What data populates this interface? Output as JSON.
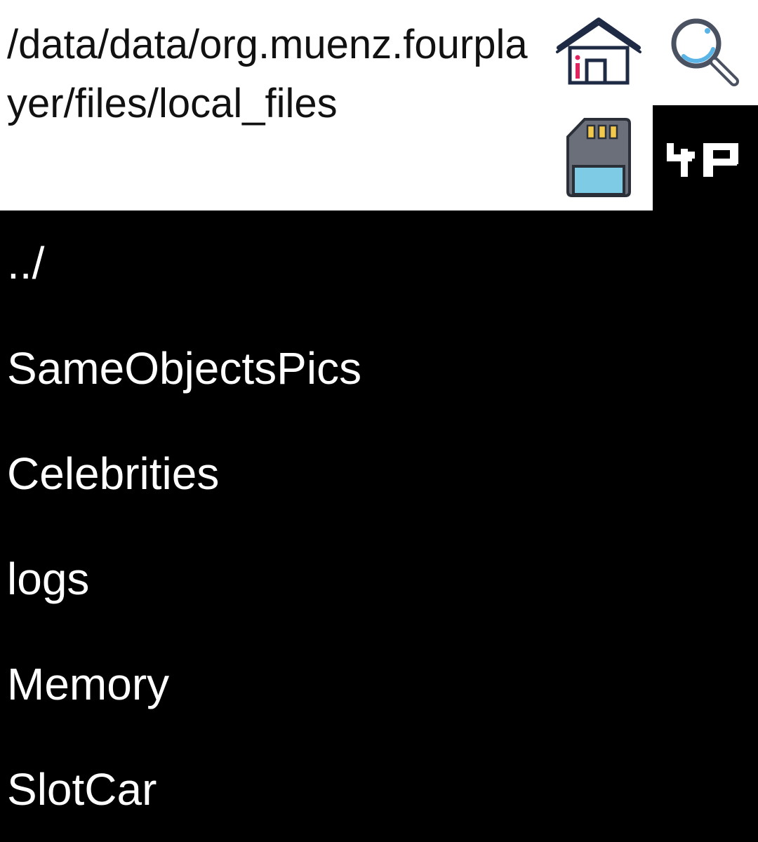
{
  "header": {
    "current_path": "/data/data/org.muenz.fourplayer/files/local_files"
  },
  "icons": {
    "home": "home-icon",
    "search": "magnifier-icon",
    "sd_card": "sd-card-icon",
    "logo": "4p-logo-icon"
  },
  "colors": {
    "home_accent": "#e0245e",
    "search_lens": "#5ab4e6",
    "sd_body": "#6a6f7a",
    "sd_label": "#7ecbe6",
    "sd_pins": "#f2c94c"
  },
  "logo": {
    "text": "4P"
  },
  "files": [
    {
      "label": "../"
    },
    {
      "label": "SameObjectsPics"
    },
    {
      "label": "Celebrities"
    },
    {
      "label": "logs"
    },
    {
      "label": "Memory"
    },
    {
      "label": "SlotCar"
    }
  ]
}
